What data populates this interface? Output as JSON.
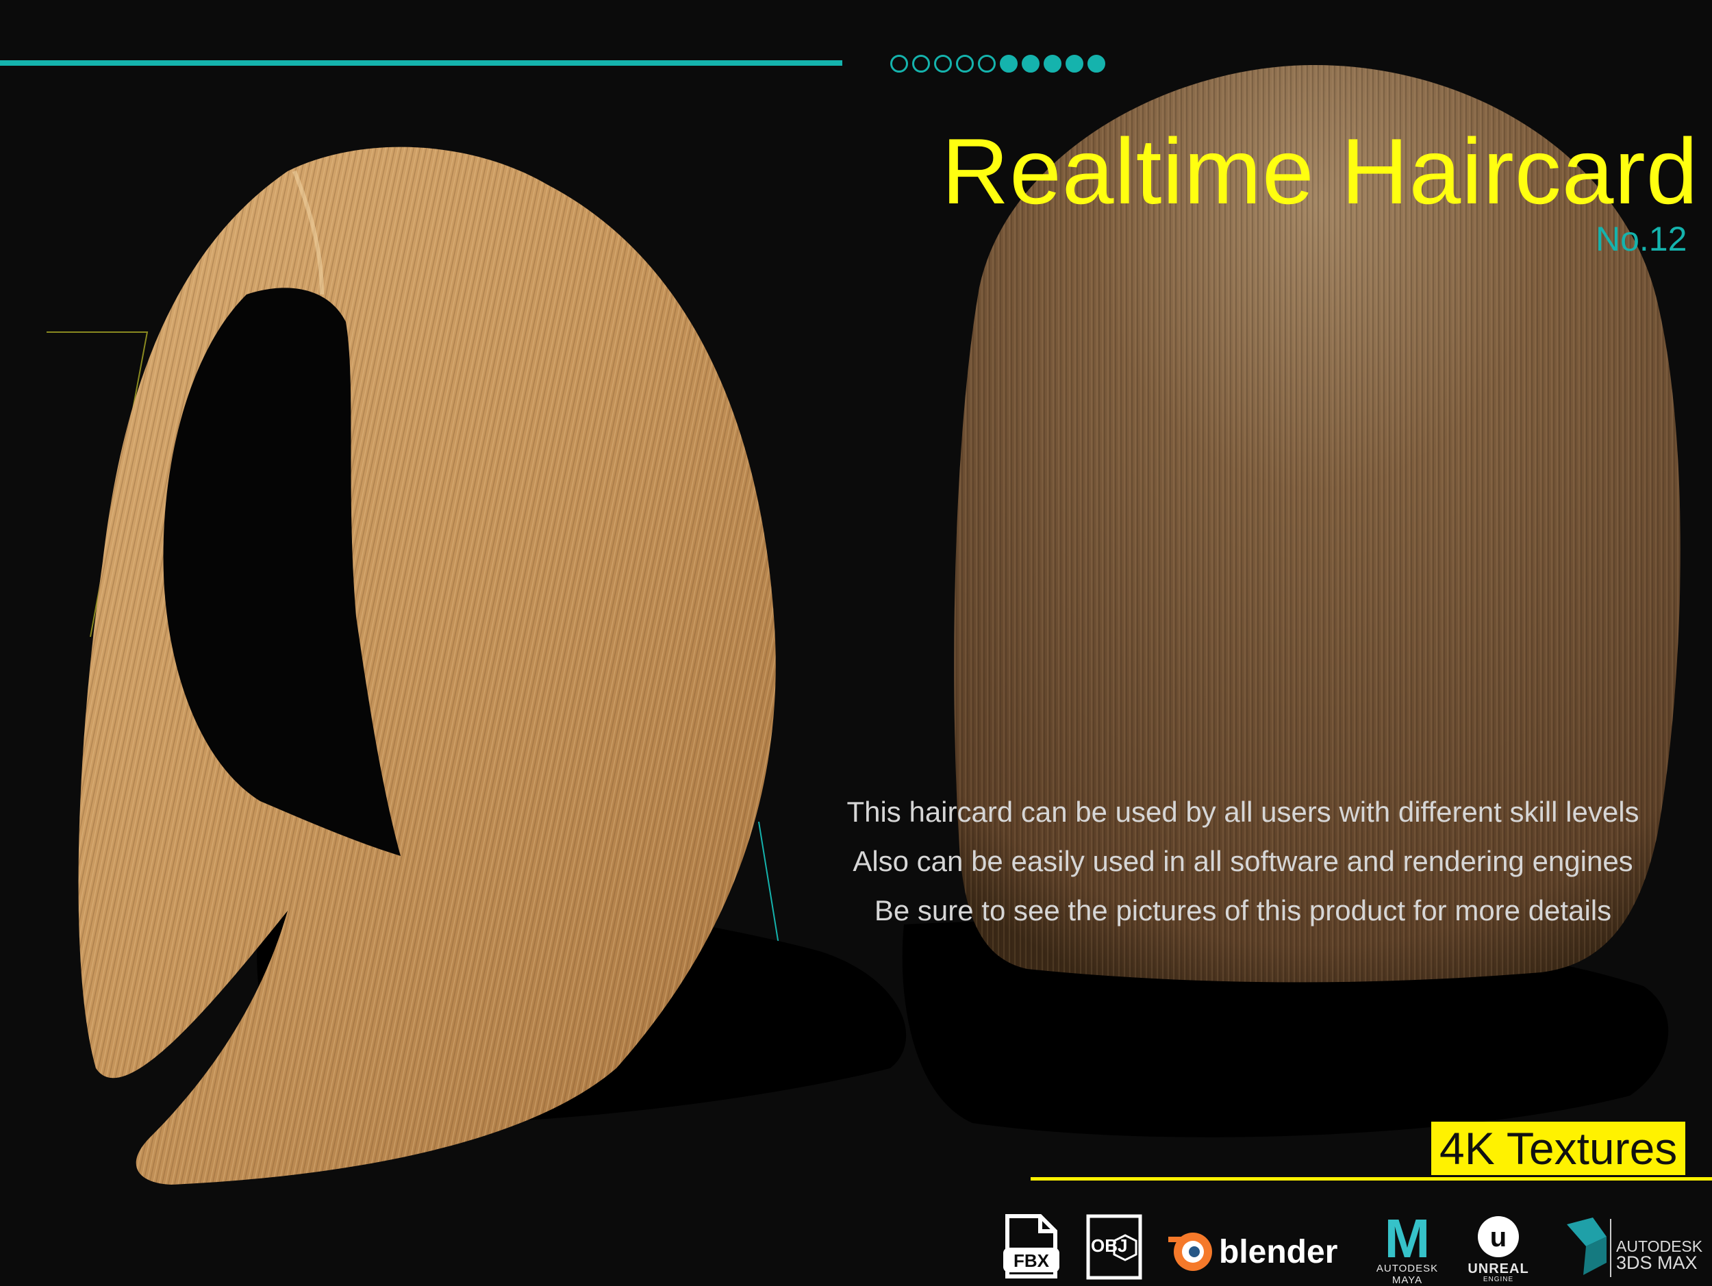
{
  "header": {
    "progress_dots": {
      "total": 10,
      "filled": 5
    }
  },
  "title": "Realtime Haircard",
  "subtitle": "No.12",
  "description": [
    "This haircard can be used by all users with different skill levels",
    "Also can be easily used in all software and rendering engines",
    "Be sure to see the pictures of this product for more details"
  ],
  "badge": "4K Textures",
  "logos": {
    "fbx": "FBX",
    "obj": "OBJ",
    "blender": "blender",
    "maya_mark": "M",
    "maya_caption": "AUTODESK MAYA",
    "unreal_mark": "u",
    "unreal_caption": "UNREAL",
    "unreal_sub": "ENGINE",
    "max_brand": "AUTODESK",
    "max_product": "3DS MAX"
  },
  "colors": {
    "accent_teal": "#15b3ad",
    "accent_yellow": "#fff200",
    "background": "#0b0b0b",
    "hair_light": "#c8985c",
    "hair_dark": "#7a5a3a"
  },
  "icons": [
    "fbx-file-icon",
    "obj-file-icon",
    "blender-logo",
    "maya-logo",
    "unreal-engine-logo",
    "3ds-max-logo"
  ]
}
